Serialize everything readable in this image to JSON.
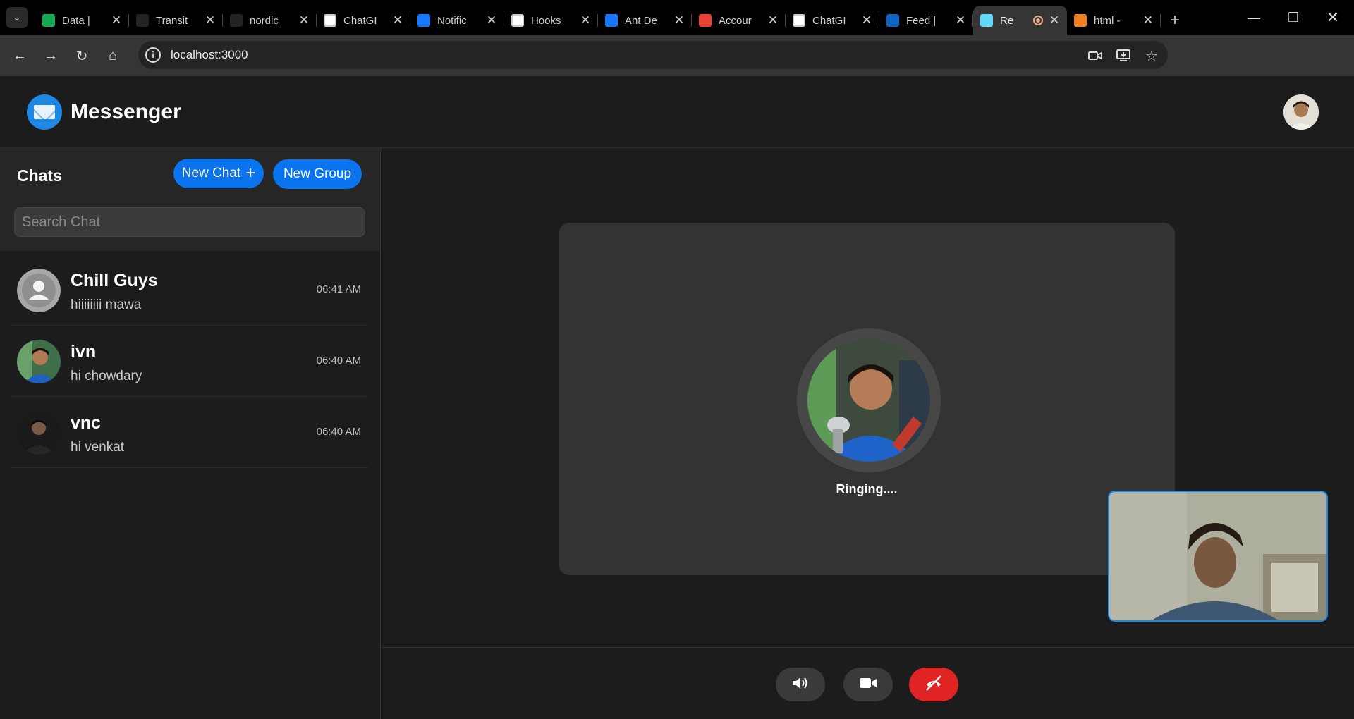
{
  "browser": {
    "tabs": [
      {
        "title": "Data |",
        "favicon_color": "#13aa52",
        "favicon_glyph": "leaf-icon"
      },
      {
        "title": "Transit",
        "favicon_color": "#222222",
        "favicon_glyph": "framer-icon"
      },
      {
        "title": "nordic",
        "favicon_color": "#222222",
        "favicon_glyph": "github-icon"
      },
      {
        "title": "ChatGI",
        "favicon_color": "#ffffff",
        "favicon_glyph": "openai-icon"
      },
      {
        "title": "Notific",
        "favicon_color": "#1677ff",
        "favicon_glyph": "antd-icon"
      },
      {
        "title": "Hooks",
        "favicon_color": "#ffffff",
        "favicon_glyph": "codesandbox-icon"
      },
      {
        "title": "Ant De",
        "favicon_color": "#1677ff",
        "favicon_glyph": "antd-icon"
      },
      {
        "title": "Accour",
        "favicon_color": "#ea4335",
        "favicon_glyph": "gmail-icon"
      },
      {
        "title": "ChatGI",
        "favicon_color": "#ffffff",
        "favicon_glyph": "openai-icon"
      },
      {
        "title": "Feed |",
        "favicon_color": "#0a66c2",
        "favicon_glyph": "linkedin-icon"
      },
      {
        "title": "Re",
        "favicon_color": "#61dafb",
        "favicon_glyph": "react-icon",
        "active": true
      },
      {
        "title": "html -",
        "favicon_color": "#f48024",
        "favicon_glyph": "stackoverflow-icon"
      }
    ],
    "url": "localhost:3000"
  },
  "app": {
    "title": "Messenger",
    "accent_color": "#0a74ef"
  },
  "sidebar": {
    "title": "Chats",
    "new_chat_label": "New Chat",
    "new_group_label": "New Group",
    "search_placeholder": "Search Chat",
    "chats": [
      {
        "name": "Chill Guys",
        "preview": "hiiiiiiii mawa",
        "time": "06:41 AM",
        "avatar": "group-default"
      },
      {
        "name": "ivn",
        "preview": "hi chowdary",
        "time": "06:40 AM",
        "avatar": "photo"
      },
      {
        "name": "vnc",
        "preview": "hi venkat",
        "time": "06:40 AM",
        "avatar": "photo"
      }
    ]
  },
  "call": {
    "status": "Ringing....",
    "end_color": "#e02424"
  }
}
